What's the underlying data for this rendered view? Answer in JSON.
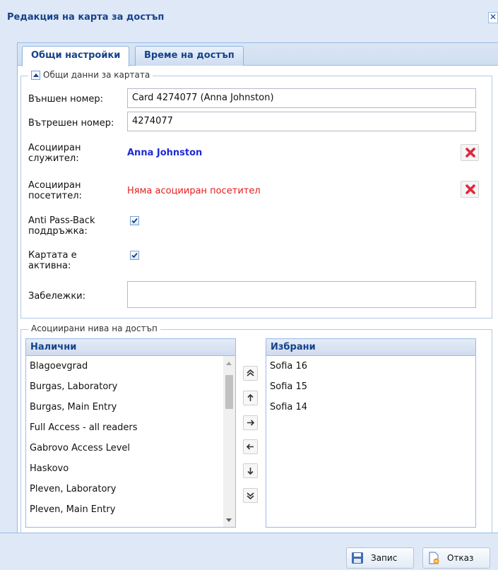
{
  "window": {
    "title": "Редакция на карта за достъп",
    "close_glyph": "✕"
  },
  "tabs": [
    {
      "label": "Общи настройки",
      "active": true
    },
    {
      "label": "Време на достъп",
      "active": false
    }
  ],
  "card_group": {
    "legend": "Общи данни за картата",
    "external_number_label": "Външен номер:",
    "external_number_value": "Card 4274077 (Anna Johnston)",
    "internal_number_label": "Вътрешен номер:",
    "internal_number_value": "4274077",
    "employee_label_1": "Асоцииран",
    "employee_label_2": "служител:",
    "employee_value": "Anna Johnston",
    "visitor_label_1": "Асоцииран",
    "visitor_label_2": "посетител:",
    "visitor_value": "Няма асоцииран посетител",
    "antipassback_label_1": "Anti Pass-Back",
    "antipassback_label_2": "поддръжка:",
    "antipassback_checked": true,
    "active_label_1": "Картата е",
    "active_label_2": "активна:",
    "active_checked": true,
    "notes_label": "Забележки:",
    "notes_value": ""
  },
  "access_levels": {
    "legend": "Асоциирани нива на достъп",
    "available_header": "Налични",
    "selected_header": "Избрани",
    "available": [
      "Blagoevgrad",
      "Burgas, Laboratory",
      "Burgas, Main Entry",
      "Full Access - all readers",
      "Gabrovo Access Level",
      "Haskovo",
      "Pleven, Laboratory",
      "Pleven, Main Entry"
    ],
    "selected": [
      "Sofia 16",
      "Sofia 15",
      "Sofia 14"
    ]
  },
  "footer": {
    "save_label": "Запис",
    "cancel_label": "Отказ"
  },
  "colors": {
    "accent": "#15428b",
    "employee": "#1f2ad6",
    "visitor": "#e21f1f",
    "delete": "#e0283b"
  }
}
